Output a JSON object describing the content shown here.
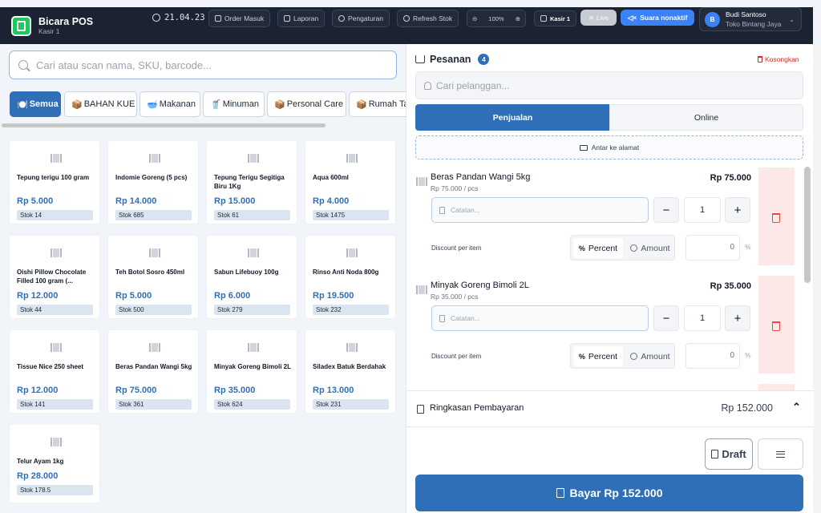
{
  "header": {
    "app_name": "Bicara POS",
    "register": "Kasir 1",
    "date": "21.04.23",
    "buttons": {
      "order_in": "Order Masuk",
      "reports": "Laporan",
      "settings": "Pengaturan",
      "refresh_stock": "Refresh Stok"
    },
    "zoom": "100%",
    "register_badge": "Kasir 1",
    "live": "Live",
    "voice": "Suara nonaktif",
    "user": {
      "initial": "B",
      "name": "Budi Santoso",
      "store": "Toko Bintang Jaya"
    }
  },
  "search": {
    "placeholder": "Cari atau scan nama, SKU, barcode..."
  },
  "categories": [
    {
      "label": "Semua",
      "icon": "plate-icon",
      "active": true
    },
    {
      "label": "BAHAN KUE",
      "icon": "box-icon",
      "active": false
    },
    {
      "label": "Makanan",
      "icon": "bowl-icon",
      "active": false
    },
    {
      "label": "Minuman",
      "icon": "drink-icon",
      "active": false
    },
    {
      "label": "Personal Care",
      "icon": "box-icon",
      "active": false
    },
    {
      "label": "Rumah Tangga",
      "icon": "box-icon",
      "active": false
    }
  ],
  "products": [
    {
      "name": "Tepung terigu 100 gram",
      "price": "Rp 5.000",
      "stock": "Stok 14"
    },
    {
      "name": "Indomie Goreng (5 pcs)",
      "price": "Rp 14.000",
      "stock": "Stok 685"
    },
    {
      "name": "Tepung Terigu Segitiga Biru 1Kg",
      "price": "Rp 15.000",
      "stock": "Stok 61"
    },
    {
      "name": "Aqua 600ml",
      "price": "Rp 4.000",
      "stock": "Stok 1475"
    },
    {
      "name": "Oishi Pillow Chocolate Filled 100 gram (...",
      "price": "Rp 12.000",
      "stock": "Stok 44"
    },
    {
      "name": "Teh Botol Sosro 450ml",
      "price": "Rp 5.000",
      "stock": "Stok 500"
    },
    {
      "name": "Sabun Lifebuoy 100g",
      "price": "Rp 6.000",
      "stock": "Stok 279"
    },
    {
      "name": "Rinso Anti Noda 800g",
      "price": "Rp 19.500",
      "stock": "Stok 232"
    },
    {
      "name": "Tissue Nice 250 sheet",
      "price": "Rp 12.000",
      "stock": "Stok 141"
    },
    {
      "name": "Beras Pandan Wangi 5kg",
      "price": "Rp 75.000",
      "stock": "Stok 361"
    },
    {
      "name": "Minyak Goreng Bimoli 2L",
      "price": "Rp 35.000",
      "stock": "Stok 624"
    },
    {
      "name": "Siladex Batuk Berdahak",
      "price": "Rp 13.000",
      "stock": "Stok 231"
    },
    {
      "name": "Telur Ayam 1kg",
      "price": "Rp 28.000",
      "stock": "Stok 178.5"
    }
  ],
  "order": {
    "title": "Pesanan",
    "count": "4",
    "clear": "Kosongkan",
    "customer_placeholder": "Cari pelanggan...",
    "tabs": {
      "sales": "Penjualan",
      "online": "Online"
    },
    "deliver": "Antar ke alamat",
    "note_placeholder": "Catatan...",
    "discount_label": "Discount per item",
    "discount_percent": "Percent",
    "discount_amount": "Amount",
    "discount_symbol": "%",
    "items": [
      {
        "name": "Beras Pandan Wangi 5kg",
        "unit_price": "Rp 75.000 / pcs",
        "total": "Rp 75.000",
        "qty": "1",
        "discount": "0"
      },
      {
        "name": "Minyak Goreng Bimoli 2L",
        "unit_price": "Rp 35.000 / pcs",
        "total": "Rp 35.000",
        "qty": "1",
        "discount": "0"
      }
    ]
  },
  "summary": {
    "label": "Ringkasan Pembayaran",
    "total": "Rp 152.000"
  },
  "actions": {
    "draft": "Draft",
    "pay": "Bayar Rp 152.000"
  },
  "colors": {
    "primary": "#2f6fb8",
    "header_bg": "#1b2231",
    "danger": "#ef4444",
    "accent": "#3b82f6"
  }
}
